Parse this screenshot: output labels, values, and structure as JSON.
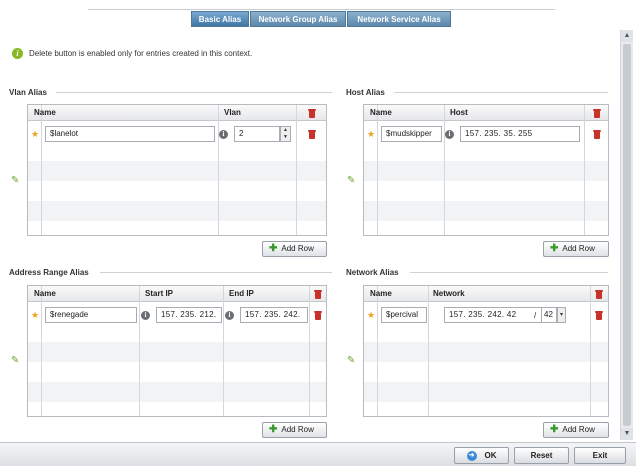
{
  "tabs": [
    {
      "label": "Basic Alias",
      "active": true
    },
    {
      "label": "Network Group Alias",
      "active": false
    },
    {
      "label": "Network Service Alias",
      "active": false
    }
  ],
  "info": {
    "icon": "info-icon",
    "text": "Delete button is enabled only for entries created in this context."
  },
  "vlan_alias": {
    "title": "Vlan Alias",
    "columns": [
      "Name",
      "Vlan"
    ],
    "rows": [
      {
        "name": "$lanelot",
        "vlan": "2"
      }
    ],
    "add_row": "Add Row"
  },
  "host_alias": {
    "title": "Host Alias",
    "columns": [
      "Name",
      "Host"
    ],
    "rows": [
      {
        "name": "$mudskipper",
        "host": "157. 235. 35. 255"
      }
    ],
    "add_row": "Add Row"
  },
  "address_range_alias": {
    "title": "Address Range Alias",
    "columns": [
      "Name",
      "Start IP",
      "End IP"
    ],
    "rows": [
      {
        "name": "$renegade",
        "start_ip": "157. 235. 212.",
        "end_ip": "157. 235. 242."
      }
    ],
    "add_row": "Add Row"
  },
  "network_alias": {
    "title": "Network Alias",
    "columns": [
      "Name",
      "Network"
    ],
    "rows": [
      {
        "name": "$percival",
        "network": "157. 235. 242. 42",
        "prefix": "42"
      }
    ],
    "add_row": "Add Row"
  },
  "footer": {
    "ok": "OK",
    "reset": "Reset",
    "exit": "Exit"
  },
  "colors": {
    "tab_active": "#3f77a6",
    "delete": "#c8322b",
    "add": "#3b9a2d",
    "star": "#f0a020"
  }
}
